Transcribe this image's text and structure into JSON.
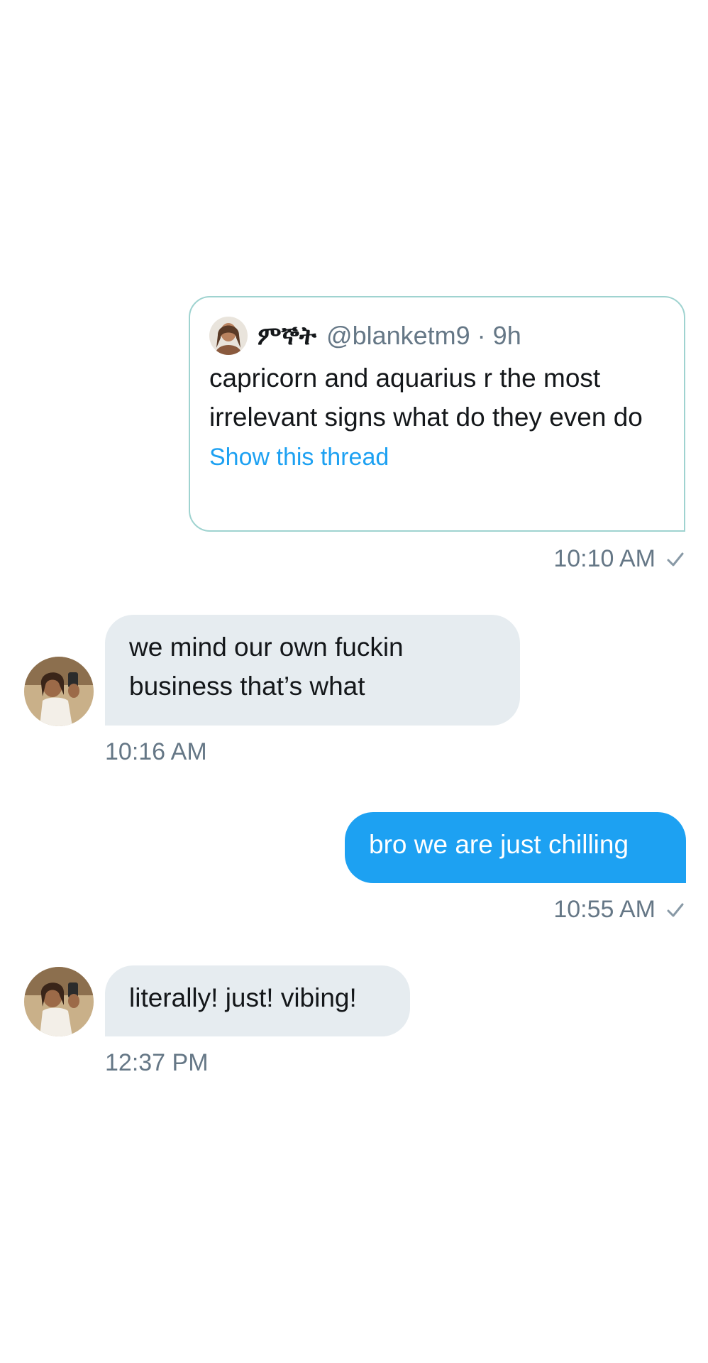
{
  "quoted_tweet": {
    "display_name": "ምኞት",
    "handle": "@blanketm9",
    "separator": "·",
    "time_ago": "9h",
    "text": "capricorn and aquarius r the most irrelevant signs what do they even do",
    "link_label": "Show this thread",
    "avatar_icon": "profile-photo"
  },
  "messages": [
    {
      "side": "out",
      "type": "tweet-share",
      "timestamp": "10:10 AM",
      "status": "sent"
    },
    {
      "side": "in",
      "text": "we mind our own fuckin business that’s what",
      "timestamp": "10:16 AM"
    },
    {
      "side": "out",
      "text": "bro we are just chilling",
      "timestamp": "10:55 AM",
      "status": "sent"
    },
    {
      "side": "in",
      "text": "literally! just! vibing!",
      "timestamp": "12:37 PM"
    }
  ],
  "colors": {
    "outgoing_bubble": "#1da1f2",
    "incoming_bubble": "#e6ecf0",
    "link": "#1da1f2",
    "card_border": "#9fd3d0",
    "secondary_text": "#657786"
  }
}
